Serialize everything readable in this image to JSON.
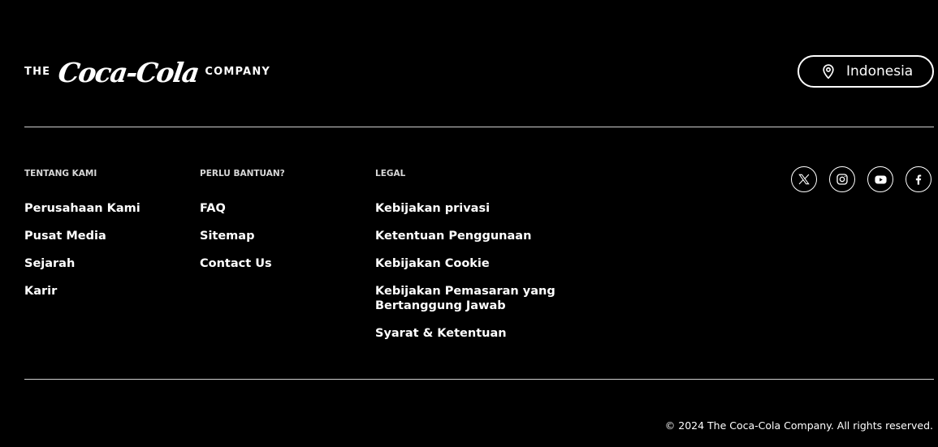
{
  "header": {
    "logo": {
      "prefix": "THE",
      "brand": "Coca-Cola",
      "suffix": "COMPANY"
    },
    "region": {
      "label": "Indonesia",
      "icon": "location-pin-icon"
    }
  },
  "columns": [
    {
      "heading": "TENTANG KAMI",
      "links": [
        "Perusahaan Kami",
        "Pusat Media",
        "Sejarah",
        "Karir"
      ]
    },
    {
      "heading": "PERLU BANTUAN?",
      "links": [
        "FAQ",
        "Sitemap",
        "Contact Us"
      ]
    },
    {
      "heading": "LEGAL",
      "links": [
        "Kebijakan privasi",
        "Ketentuan Penggunaan",
        "Kebijakan Cookie",
        "Kebijakan Pemasaran yang Bertanggung Jawab",
        "Syarat & Ketentuan"
      ]
    }
  ],
  "social": [
    {
      "icon": "x-twitter-icon"
    },
    {
      "icon": "instagram-icon"
    },
    {
      "icon": "youtube-icon"
    },
    {
      "icon": "facebook-icon"
    }
  ],
  "footer": {
    "copyright": "© 2024 The Coca-Cola Company. All rights reserved."
  },
  "colors": {
    "background": "#000000",
    "text": "#ffffff",
    "heading": "#d8d8d8",
    "divider": "#cfcfcf"
  }
}
